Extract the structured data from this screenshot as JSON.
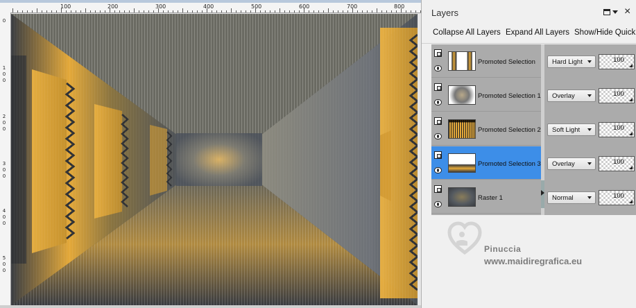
{
  "rulers": {
    "top_ticks": [
      "100",
      "200",
      "300",
      "400",
      "500",
      "600",
      "700",
      "800"
    ],
    "left_ticks": [
      [
        "0"
      ],
      [
        "1",
        "0",
        "0"
      ],
      [
        "2",
        "0",
        "0"
      ],
      [
        "3",
        "0",
        "0"
      ],
      [
        "4",
        "0",
        "0"
      ],
      [
        "5",
        "0",
        "0"
      ]
    ]
  },
  "palette": {
    "title": "Layers",
    "toolbar": {
      "collapse": "Collapse All Layers",
      "expand": "Expand All Layers",
      "show_hide": "Show/Hide Quick"
    },
    "layers": [
      {
        "name": "Promoted Selection",
        "blend": "Hard Light",
        "opacity": "100",
        "selected": false
      },
      {
        "name": "Promoted Selection 1",
        "blend": "Overlay",
        "opacity": "100",
        "selected": false
      },
      {
        "name": "Promoted Selection 2",
        "blend": "Soft Light",
        "opacity": "100",
        "selected": false
      },
      {
        "name": "Promoted Selection 3",
        "blend": "Overlay",
        "opacity": "100",
        "selected": true
      },
      {
        "name": "Raster 1",
        "blend": "Normal",
        "opacity": "100",
        "selected": false
      }
    ]
  },
  "watermark": {
    "name": "Pinuccia",
    "url": "www.maidiregrafica.eu"
  },
  "colors": {
    "selection": "#3d8ee8",
    "gold": "#e4a93a",
    "slate": "#5a6068"
  }
}
